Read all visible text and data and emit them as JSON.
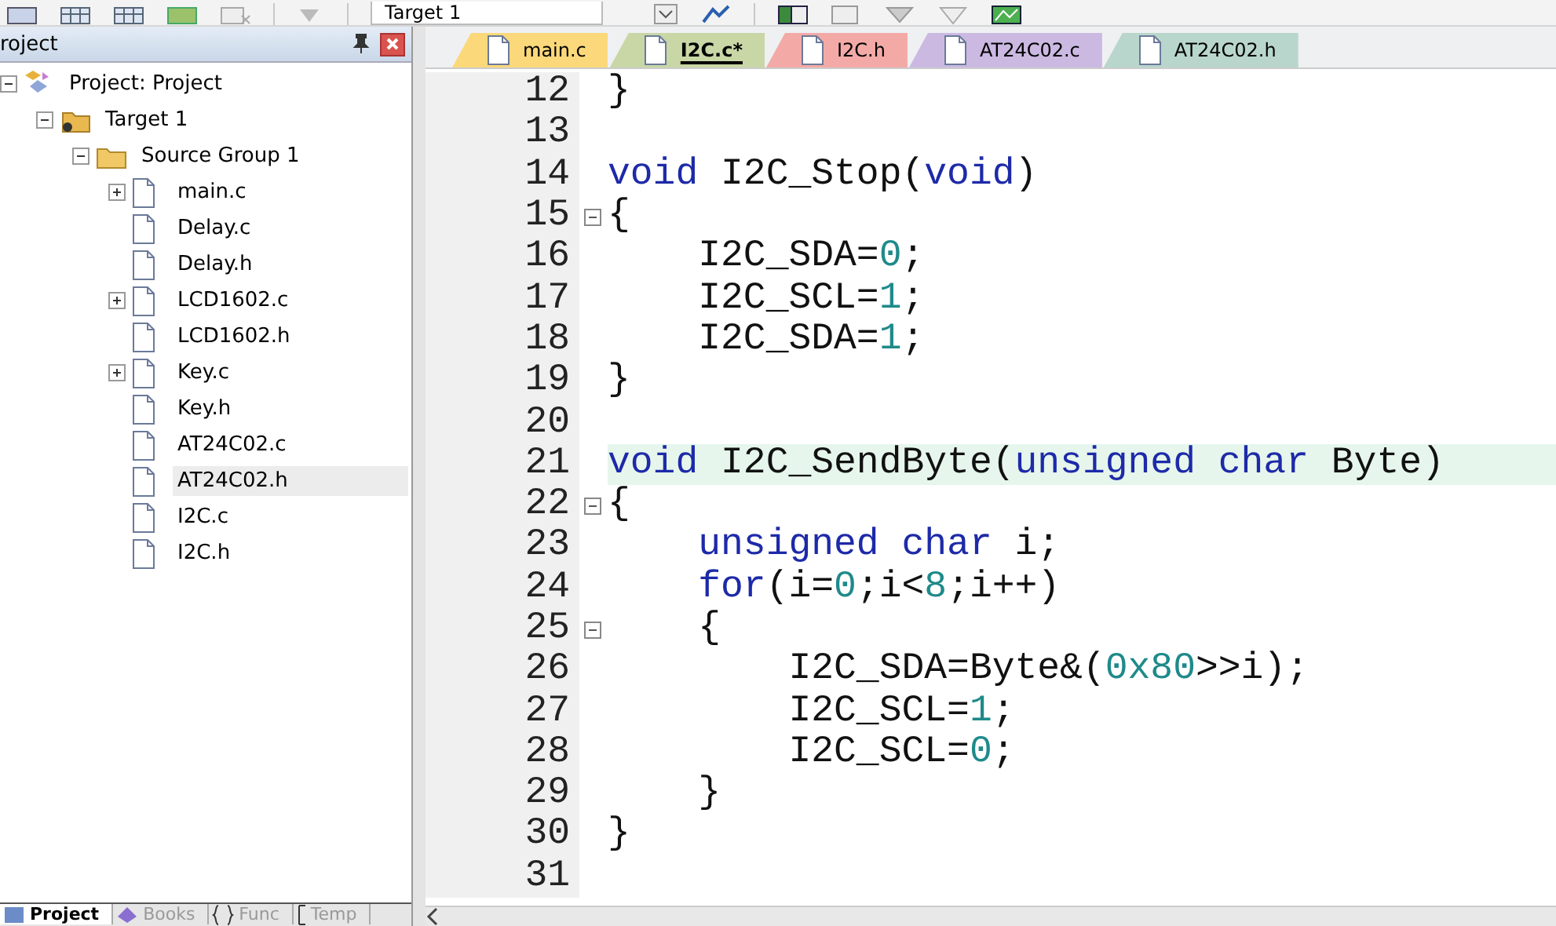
{
  "toolbar": {
    "target": "Target 1"
  },
  "project_panel": {
    "title": "roject",
    "tree": [
      {
        "label": "Project: Project",
        "kind": "project",
        "expanded": true,
        "children": [
          {
            "label": "Target 1",
            "kind": "target",
            "expanded": true,
            "children": [
              {
                "label": "Source Group 1",
                "kind": "group",
                "expanded": true,
                "children": [
                  {
                    "label": "main.c",
                    "kind": "file",
                    "expandable": true,
                    "selected": false
                  },
                  {
                    "label": "Delay.c",
                    "kind": "file",
                    "expandable": false,
                    "selected": false
                  },
                  {
                    "label": "Delay.h",
                    "kind": "file",
                    "expandable": false,
                    "selected": false
                  },
                  {
                    "label": "LCD1602.c",
                    "kind": "file",
                    "expandable": true,
                    "selected": false
                  },
                  {
                    "label": "LCD1602.h",
                    "kind": "file",
                    "expandable": false,
                    "selected": false
                  },
                  {
                    "label": "Key.c",
                    "kind": "file",
                    "expandable": true,
                    "selected": false
                  },
                  {
                    "label": "Key.h",
                    "kind": "file",
                    "expandable": false,
                    "selected": false
                  },
                  {
                    "label": "AT24C02.c",
                    "kind": "file",
                    "expandable": false,
                    "selected": false
                  },
                  {
                    "label": "AT24C02.h",
                    "kind": "file",
                    "expandable": false,
                    "selected": true
                  },
                  {
                    "label": "I2C.c",
                    "kind": "file",
                    "expandable": false,
                    "selected": false
                  },
                  {
                    "label": "I2C.h",
                    "kind": "file",
                    "expandable": false,
                    "selected": false
                  }
                ]
              }
            ]
          }
        ]
      }
    ],
    "bottom_tabs": [
      {
        "label": "Project",
        "selected": true
      },
      {
        "label": "Books",
        "selected": false
      },
      {
        "label": "Func",
        "selected": false
      },
      {
        "label": "Temp",
        "selected": false
      }
    ]
  },
  "editor_tabs": [
    {
      "label": "main.c",
      "color": "#fbd87a",
      "selected": false
    },
    {
      "label": "I2C.c*",
      "color": "#c9d6a6",
      "selected": true
    },
    {
      "label": "I2C.h",
      "color": "#f3aaa6",
      "selected": false
    },
    {
      "label": "AT24C02.c",
      "color": "#cbb9e2",
      "selected": false
    },
    {
      "label": "AT24C02.h",
      "color": "#b9d6cc",
      "selected": false
    }
  ],
  "code_lines": [
    {
      "number": "12",
      "foldable": false,
      "selected": false,
      "tokens": [
        {
          "text": "}",
          "kind": "plain"
        }
      ]
    },
    {
      "number": "13",
      "foldable": false,
      "selected": false
    },
    {
      "number": "14",
      "foldable": false,
      "selected": false,
      "tokens": [
        {
          "text": "void",
          "kind": "keyword"
        },
        {
          "text": " I2C_Stop(",
          "kind": "plain"
        },
        {
          "text": "void",
          "kind": "keyword"
        },
        {
          "text": ")",
          "kind": "plain"
        }
      ]
    },
    {
      "number": "15",
      "foldable": true,
      "selected": false,
      "tokens": [
        {
          "text": "{",
          "kind": "plain"
        }
      ]
    },
    {
      "number": "16",
      "foldable": false,
      "selected": false,
      "tokens": [
        {
          "text": "    I2C_SDA=",
          "kind": "plain"
        },
        {
          "text": "0",
          "kind": "number"
        },
        {
          "text": ";",
          "kind": "plain"
        }
      ]
    },
    {
      "number": "17",
      "foldable": false,
      "selected": false,
      "tokens": [
        {
          "text": "    I2C_SCL=",
          "kind": "plain"
        },
        {
          "text": "1",
          "kind": "number"
        },
        {
          "text": ";",
          "kind": "plain"
        }
      ]
    },
    {
      "number": "18",
      "foldable": false,
      "selected": false,
      "tokens": [
        {
          "text": "    I2C_SDA=",
          "kind": "plain"
        },
        {
          "text": "1",
          "kind": "number"
        },
        {
          "text": ";",
          "kind": "plain"
        }
      ]
    },
    {
      "number": "19",
      "foldable": false,
      "selected": false,
      "tokens": [
        {
          "text": "}",
          "kind": "plain"
        }
      ]
    },
    {
      "number": "20",
      "foldable": false,
      "selected": false
    },
    {
      "number": "21",
      "foldable": false,
      "selected": true,
      "tokens": [
        {
          "text": "void",
          "kind": "keyword"
        },
        {
          "text": " I2C_SendByte(",
          "kind": "plain"
        },
        {
          "text": "unsigned",
          "kind": "keyword"
        },
        {
          "text": " char",
          "kind": "keyword"
        },
        {
          "text": " Byte)",
          "kind": "plain"
        }
      ]
    },
    {
      "number": "22",
      "foldable": true,
      "selected": false,
      "tokens": [
        {
          "text": "{",
          "kind": "plain"
        }
      ]
    },
    {
      "number": "23",
      "foldable": false,
      "selected": false,
      "tokens": [
        {
          "text": "    unsigned",
          "kind": "keyword"
        },
        {
          "text": " char",
          "kind": "keyword"
        },
        {
          "text": " i;",
          "kind": "plain"
        }
      ]
    },
    {
      "number": "24",
      "foldable": false,
      "selected": false,
      "tokens": [
        {
          "text": "    for",
          "kind": "keyword"
        },
        {
          "text": "(i=",
          "kind": "plain"
        },
        {
          "text": "0",
          "kind": "number"
        },
        {
          "text": ";i<",
          "kind": "plain"
        },
        {
          "text": "8",
          "kind": "number"
        },
        {
          "text": ";i++)",
          "kind": "plain"
        }
      ]
    },
    {
      "number": "25",
      "foldable": true,
      "selected": false,
      "tokens": [
        {
          "text": "    {",
          "kind": "plain"
        }
      ]
    },
    {
      "number": "26",
      "foldable": false,
      "selected": false,
      "tokens": [
        {
          "text": "        I2C_SDA=Byte&(",
          "kind": "plain"
        },
        {
          "text": "0x80",
          "kind": "number"
        },
        {
          "text": ">>i);",
          "kind": "plain"
        }
      ]
    },
    {
      "number": "27",
      "foldable": false,
      "selected": false,
      "tokens": [
        {
          "text": "        I2C_SCL=",
          "kind": "plain"
        },
        {
          "text": "1",
          "kind": "number"
        },
        {
          "text": ";",
          "kind": "plain"
        }
      ]
    },
    {
      "number": "28",
      "foldable": false,
      "selected": false,
      "tokens": [
        {
          "text": "        I2C_SCL=",
          "kind": "plain"
        },
        {
          "text": "0",
          "kind": "number"
        },
        {
          "text": ";",
          "kind": "plain"
        }
      ]
    },
    {
      "number": "29",
      "foldable": false,
      "selected": false,
      "tokens": [
        {
          "text": "    }",
          "kind": "plain"
        }
      ]
    },
    {
      "number": "30",
      "foldable": false,
      "selected": false,
      "tokens": [
        {
          "text": "}",
          "kind": "plain"
        }
      ]
    },
    {
      "number": "31",
      "foldable": false,
      "selected": false
    }
  ]
}
